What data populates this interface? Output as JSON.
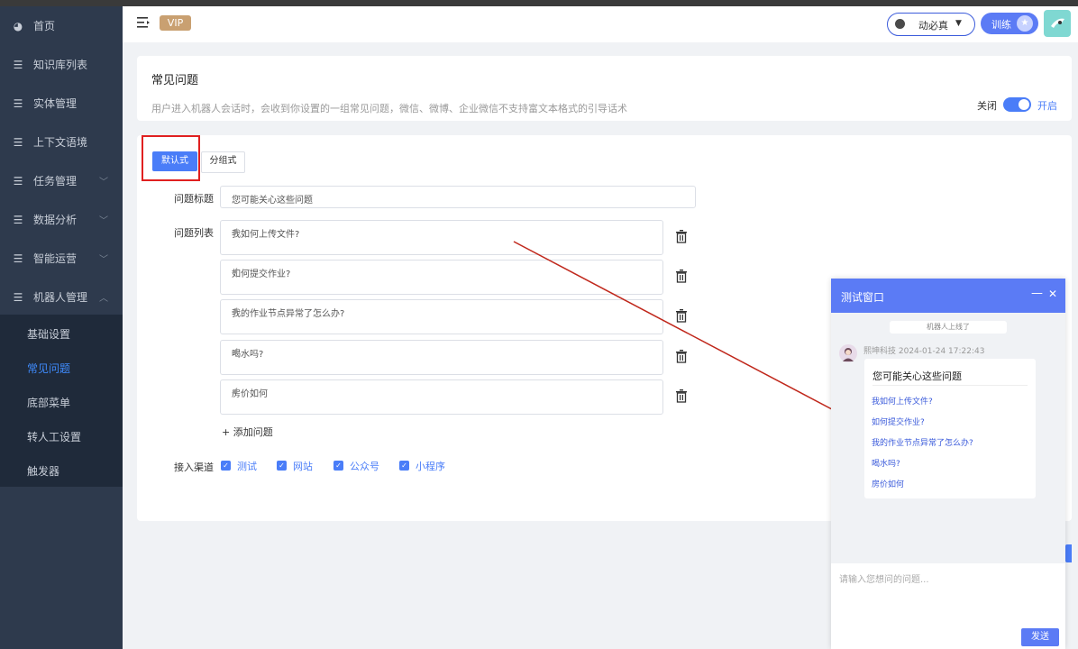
{
  "sidebar": {
    "items": [
      {
        "label": "首页",
        "icon": "dashboard-icon"
      },
      {
        "label": "知识库列表",
        "icon": "list-icon"
      },
      {
        "label": "实体管理",
        "icon": "list-icon"
      },
      {
        "label": "上下文语境",
        "icon": "list-icon"
      },
      {
        "label": "任务管理",
        "icon": "list-icon"
      },
      {
        "label": "数据分析",
        "icon": "list-icon"
      },
      {
        "label": "智能运营",
        "icon": "list-icon"
      },
      {
        "label": "机器人管理",
        "icon": "list-icon"
      }
    ],
    "submenu": [
      "基础设置",
      "常见问题",
      "底部菜单",
      "转人工设置",
      "触发器"
    ]
  },
  "header": {
    "vip": "VIP",
    "user_name": "动必真",
    "train_label": "训练"
  },
  "faq": {
    "title": "常见问题",
    "description": "用户进入机器人会话时，会收到你设置的一组常见问题，微信、微博、企业微信不支持富文本格式的引导话术",
    "switch_off": "关闭",
    "switch_on": "开启",
    "enabled": true
  },
  "tabs": {
    "default": "默认式",
    "group": "分组式"
  },
  "form": {
    "title_label": "问题标题",
    "title_value": "您可能关心这些问题",
    "list_label": "问题列表",
    "questions": [
      "我如何上传文件?",
      "如何提交作业?",
      "我的作业节点异常了怎么办?",
      "喝水吗?",
      "房价如何"
    ],
    "add_label": "+ 添加问题",
    "channel_label": "接入渠道",
    "channels": [
      "测试",
      "网站",
      "公众号",
      "小程序"
    ]
  },
  "test_window": {
    "title": "测试窗口",
    "minimize": "—",
    "close": "✕",
    "online": "机器人上线了",
    "sender": "熙坤科技 2024-01-24 17:22:43",
    "bubble_title": "您可能关心这些问题",
    "questions": [
      "我如何上传文件?",
      "如何提交作业?",
      "我的作业节点异常了怎么办?",
      "喝水吗?",
      "房价如何"
    ],
    "input_placeholder": "请输入您想问的问题...",
    "send": "发送"
  },
  "colors": {
    "primary": "#4a7df8",
    "sidebar": "#2e3a4d",
    "vip": "#c9a071",
    "highlight": "#e02020"
  }
}
